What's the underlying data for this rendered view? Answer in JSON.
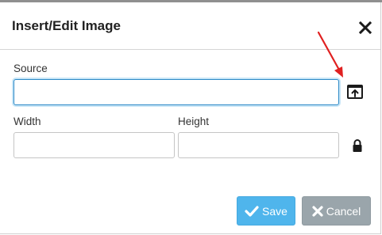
{
  "dialog": {
    "title": "Insert/Edit Image",
    "close_icon": "close-icon"
  },
  "form": {
    "source": {
      "label": "Source",
      "value": "",
      "browse_icon": "browse-upload-icon"
    },
    "width": {
      "label": "Width",
      "value": ""
    },
    "height": {
      "label": "Height",
      "value": ""
    },
    "constrain_icon": "lock-icon"
  },
  "buttons": {
    "save_label": "Save",
    "save_icon": "checkmark-icon",
    "cancel_label": "Cancel",
    "cancel_icon": "x-icon"
  },
  "annotation": {
    "arrow_color": "#e02020"
  },
  "colors": {
    "accent": "#4fb5ec",
    "focus_border": "#2d8ac7",
    "cancel": "#9aa5ab"
  }
}
